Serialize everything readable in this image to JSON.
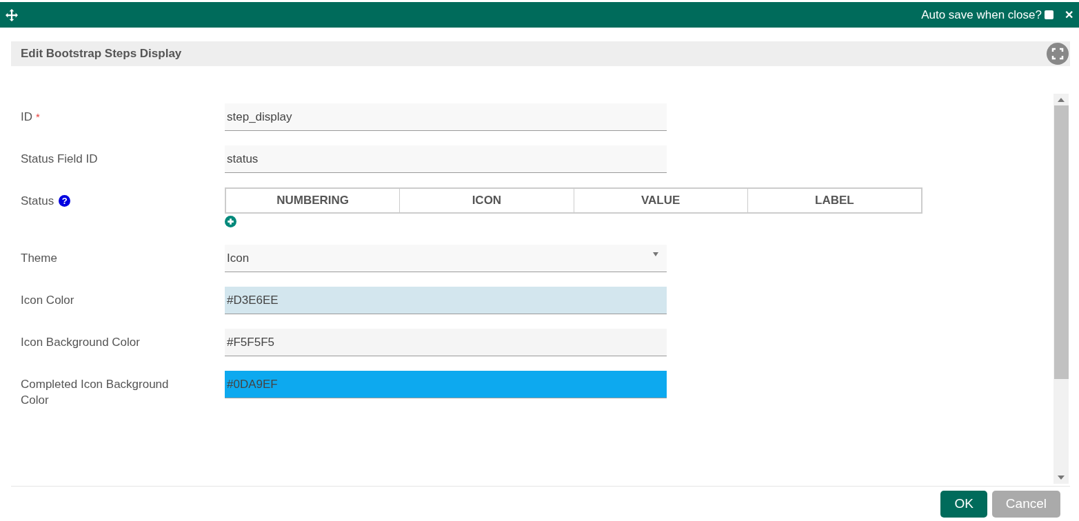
{
  "top_bar": {
    "auto_save_label": "Auto save when close?",
    "auto_save_checked": false,
    "close": "✕"
  },
  "dialog": {
    "title": "Edit Bootstrap Steps Display"
  },
  "fields": [
    {
      "kind": "text",
      "label": "ID",
      "required_mark": "*",
      "value": "step_display"
    },
    {
      "kind": "text",
      "label": "Status Field ID",
      "value": "status"
    },
    {
      "kind": "table",
      "label": "Status",
      "help": "?",
      "columns": [
        "NUMBERING",
        "ICON",
        "VALUE",
        "LABEL"
      ]
    },
    {
      "kind": "select",
      "label": "Theme",
      "value": "Icon"
    },
    {
      "kind": "color",
      "label": "Icon Color",
      "value": "#D3E6EE",
      "color": "#d3e6ee"
    },
    {
      "kind": "color",
      "label": "Icon Background Color",
      "value": "#F5F5F5",
      "color": "#f5f5f5"
    },
    {
      "kind": "color",
      "label": "Completed Icon Background Color",
      "value": "#0DA9EF",
      "color": "#0da9ef"
    }
  ],
  "buttons": [
    {
      "label": "OK",
      "kind": "primary"
    },
    {
      "label": "Cancel",
      "kind": "secondary"
    }
  ]
}
